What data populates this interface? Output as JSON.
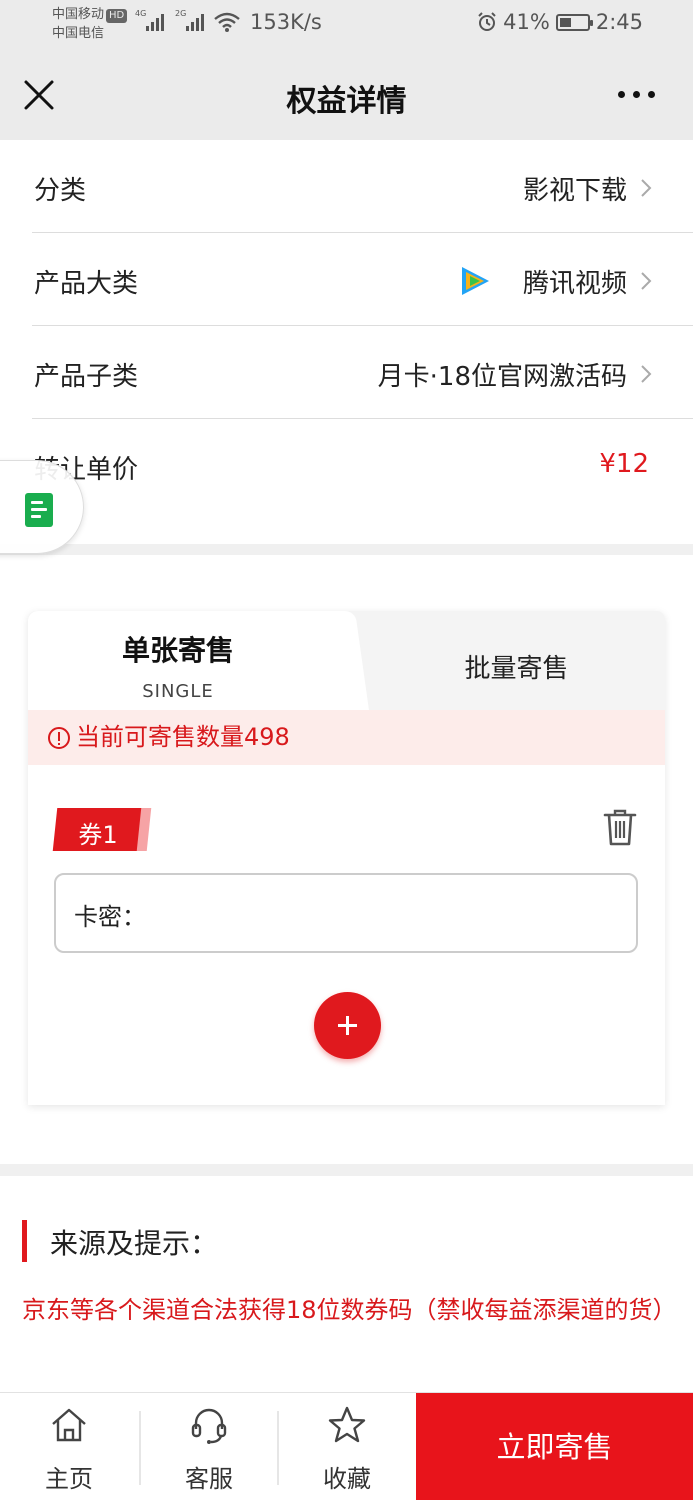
{
  "status_bar": {
    "carrier1": "中国移动",
    "hd": "HD",
    "carrier2": "中国电信",
    "sig1": "4G",
    "sig2": "2G",
    "speed": "153K/s",
    "battery": "41%",
    "battery_level": 0.41,
    "time": "2:45"
  },
  "nav": {
    "title": "权益详情"
  },
  "info_rows": {
    "category_label": "分类",
    "category_value": "影视下载",
    "product_label": "产品大类",
    "product_value": "腾讯视频",
    "sub_label": "产品子类",
    "sub_value": "月卡·18位官网激活码",
    "price_label": "转让单价",
    "price_value": "¥12"
  },
  "card": {
    "tab_single": "单张寄售",
    "tab_single_sub": "SINGLE",
    "tab_batch": "批量寄售",
    "notice": "当前可寄售数量498",
    "coupon_label": "券1",
    "code_label": "卡密：",
    "code_value": ""
  },
  "source": {
    "title": "来源及提示：",
    "desc": "京东等各个渠道合法获得18位数券码（禁收每益添渠道的货）"
  },
  "bottom": {
    "home": "主页",
    "service": "客服",
    "favorite": "收藏",
    "sell": "立即寄售"
  },
  "colors": {
    "accent": "#e0191e",
    "notice_bg": "#fdecea",
    "bar_bg": "#ebebeb"
  }
}
